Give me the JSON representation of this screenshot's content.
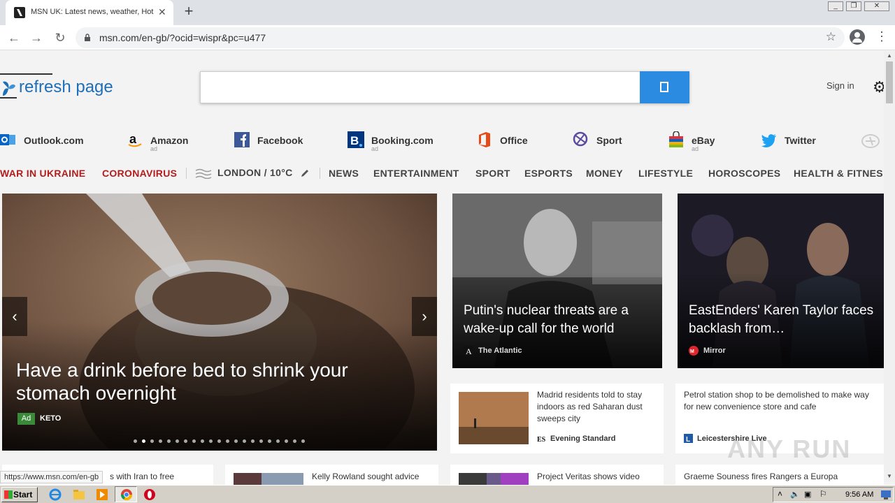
{
  "browser": {
    "tab_title": "MSN UK: Latest news, weather, Hot",
    "tab_close": "✕",
    "new_tab": "+",
    "url": "msn.com/en-gb/?ocid=wispr&pc=u477",
    "back": "←",
    "forward": "→",
    "reload": "↻",
    "star": "☆",
    "menu": "⋮"
  },
  "header": {
    "logo_text": "refresh page",
    "sign_in": "Sign in",
    "settings_icon": "⚙"
  },
  "quick_links": [
    {
      "label": "Outlook.com",
      "ad": "",
      "icon": "outlook-icon"
    },
    {
      "label": "Amazon",
      "ad": "ad",
      "icon": "amazon-icon"
    },
    {
      "label": "Facebook",
      "ad": "",
      "icon": "facebook-icon"
    },
    {
      "label": "Booking.com",
      "ad": "ad",
      "icon": "booking-icon"
    },
    {
      "label": "Office",
      "ad": "",
      "icon": "office-icon"
    },
    {
      "label": "Sport",
      "ad": "",
      "icon": "sport-icon"
    },
    {
      "label": "eBay",
      "ad": "ad",
      "icon": "ebay-icon"
    },
    {
      "label": "Twitter",
      "ad": "",
      "icon": "twitter-icon"
    }
  ],
  "nav": {
    "war": "WAR IN UKRAINE",
    "corona": "CORONAVIRUS",
    "weather": "LONDON / 10°C",
    "items": [
      "NEWS",
      "ENTERTAINMENT",
      "SPORT",
      "ESPORTS",
      "MONEY",
      "LIFESTYLE",
      "HOROSCOPES",
      "HEALTH & FITNES"
    ]
  },
  "hero": {
    "headline": "Have a drink before bed to shrink your stomach overnight",
    "ad_badge": "Ad",
    "source": "KETO",
    "prev": "‹",
    "next": "›",
    "dot_count": 21,
    "active_dot": 1
  },
  "cards": [
    {
      "headline": "Putin's nuclear threats are a wake-up call for the world",
      "source": "The Atlantic"
    },
    {
      "headline": "EastEnders' Karen Taylor faces backlash from…",
      "source": "Mirror"
    }
  ],
  "tiles": [
    {
      "text": "Madrid residents told to stay indoors as red Saharan dust sweeps city",
      "source": "Evening Standard"
    },
    {
      "text": "Petrol station shop to be demolished to make way for new convenience store and cafe",
      "source": "Leicestershire Live"
    },
    {
      "text": "s with Iran to free",
      "source": ""
    },
    {
      "text": "Kelly Rowland sought advice",
      "source": ""
    },
    {
      "text": "Project Veritas shows video",
      "source": ""
    },
    {
      "text": "Graeme Souness fires Rangers a Europa",
      "source": ""
    }
  ],
  "status_url": "https://www.msn.com/en-gb",
  "taskbar": {
    "start": "Start",
    "clock": "9:56 AM"
  },
  "watermark": "ANY RUN",
  "colors": {
    "accent": "#2b8be0",
    "logo": "#1e6fb7",
    "nav_red": "#b31d1d",
    "ad_green": "#3a8a3a"
  }
}
